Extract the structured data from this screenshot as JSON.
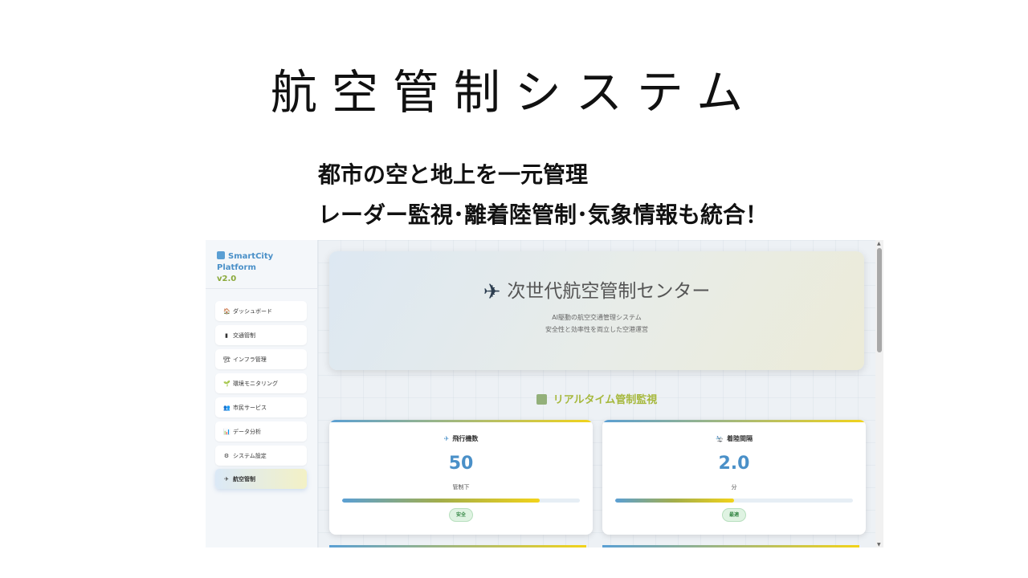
{
  "slide": {
    "title": "航空管制システム",
    "subtitle_line1": "都市の空と地上を一元管理",
    "subtitle_line2": "レーダー監視･離着陸管制･気象情報も統合！"
  },
  "sidebar": {
    "brand_name": "SmartCity Platform",
    "brand_version": "v2.0",
    "items": [
      {
        "icon": "🏠",
        "label": "ダッシュボード"
      },
      {
        "icon": "▮",
        "label": "交通管制"
      },
      {
        "icon": "🏗",
        "label": "インフラ管理"
      },
      {
        "icon": "🌱",
        "label": "環境モニタリング"
      },
      {
        "icon": "👥",
        "label": "市民サービス"
      },
      {
        "icon": "📊",
        "label": "データ分析"
      },
      {
        "icon": "⚙",
        "label": "システム設定"
      },
      {
        "icon": "✈",
        "label": "航空管制"
      }
    ],
    "active_index": 7
  },
  "hero": {
    "icon": "✈",
    "title": "次世代航空管制センター",
    "line1": "AI駆動の航空交通管理システム",
    "line2": "安全性と効率性を両立した空港運営"
  },
  "section": {
    "title": "リアルタイム管制監視"
  },
  "cards": [
    {
      "icon": "✈",
      "title": "飛行機数",
      "value": "50",
      "unit": "管制下",
      "progress": 0.83,
      "badge": "安全"
    },
    {
      "icon": "🛬",
      "title": "着陸間隔",
      "value": "2.0",
      "unit": "分",
      "progress": 0.5,
      "badge": "最適"
    }
  ],
  "colors": {
    "accent_blue": "#4a90c8",
    "accent_yellow": "#f2d31a",
    "section_title": "#a6b83c",
    "badge_green": "#3a8a4a"
  }
}
